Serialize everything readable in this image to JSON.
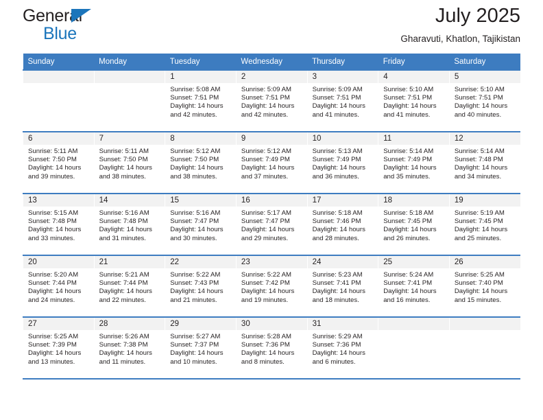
{
  "brand": {
    "name_part1": "General",
    "name_part2": "Blue",
    "logo_icon": "triangle-icon",
    "color_primary": "#1b75bb",
    "color_text": "#231f20"
  },
  "header": {
    "title": "July 2025",
    "subtitle": "Gharavuti, Khatlon, Tajikistan"
  },
  "theme": {
    "header_bg": "#3d7cc0",
    "header_text": "#ffffff",
    "daynum_bg": "#f2f2f2",
    "grid_line": "#3d7cc0"
  },
  "weekdays": [
    "Sunday",
    "Monday",
    "Tuesday",
    "Wednesday",
    "Thursday",
    "Friday",
    "Saturday"
  ],
  "weeks": [
    [
      {
        "day": "",
        "sunrise": "",
        "sunset": "",
        "daylight1": "",
        "daylight2": "",
        "empty": true
      },
      {
        "day": "",
        "sunrise": "",
        "sunset": "",
        "daylight1": "",
        "daylight2": "",
        "empty": true
      },
      {
        "day": "1",
        "sunrise": "Sunrise: 5:08 AM",
        "sunset": "Sunset: 7:51 PM",
        "daylight1": "Daylight: 14 hours",
        "daylight2": "and 42 minutes."
      },
      {
        "day": "2",
        "sunrise": "Sunrise: 5:09 AM",
        "sunset": "Sunset: 7:51 PM",
        "daylight1": "Daylight: 14 hours",
        "daylight2": "and 42 minutes."
      },
      {
        "day": "3",
        "sunrise": "Sunrise: 5:09 AM",
        "sunset": "Sunset: 7:51 PM",
        "daylight1": "Daylight: 14 hours",
        "daylight2": "and 41 minutes."
      },
      {
        "day": "4",
        "sunrise": "Sunrise: 5:10 AM",
        "sunset": "Sunset: 7:51 PM",
        "daylight1": "Daylight: 14 hours",
        "daylight2": "and 41 minutes."
      },
      {
        "day": "5",
        "sunrise": "Sunrise: 5:10 AM",
        "sunset": "Sunset: 7:51 PM",
        "daylight1": "Daylight: 14 hours",
        "daylight2": "and 40 minutes."
      }
    ],
    [
      {
        "day": "6",
        "sunrise": "Sunrise: 5:11 AM",
        "sunset": "Sunset: 7:50 PM",
        "daylight1": "Daylight: 14 hours",
        "daylight2": "and 39 minutes."
      },
      {
        "day": "7",
        "sunrise": "Sunrise: 5:11 AM",
        "sunset": "Sunset: 7:50 PM",
        "daylight1": "Daylight: 14 hours",
        "daylight2": "and 38 minutes."
      },
      {
        "day": "8",
        "sunrise": "Sunrise: 5:12 AM",
        "sunset": "Sunset: 7:50 PM",
        "daylight1": "Daylight: 14 hours",
        "daylight2": "and 38 minutes."
      },
      {
        "day": "9",
        "sunrise": "Sunrise: 5:12 AM",
        "sunset": "Sunset: 7:49 PM",
        "daylight1": "Daylight: 14 hours",
        "daylight2": "and 37 minutes."
      },
      {
        "day": "10",
        "sunrise": "Sunrise: 5:13 AM",
        "sunset": "Sunset: 7:49 PM",
        "daylight1": "Daylight: 14 hours",
        "daylight2": "and 36 minutes."
      },
      {
        "day": "11",
        "sunrise": "Sunrise: 5:14 AM",
        "sunset": "Sunset: 7:49 PM",
        "daylight1": "Daylight: 14 hours",
        "daylight2": "and 35 minutes."
      },
      {
        "day": "12",
        "sunrise": "Sunrise: 5:14 AM",
        "sunset": "Sunset: 7:48 PM",
        "daylight1": "Daylight: 14 hours",
        "daylight2": "and 34 minutes."
      }
    ],
    [
      {
        "day": "13",
        "sunrise": "Sunrise: 5:15 AM",
        "sunset": "Sunset: 7:48 PM",
        "daylight1": "Daylight: 14 hours",
        "daylight2": "and 33 minutes."
      },
      {
        "day": "14",
        "sunrise": "Sunrise: 5:16 AM",
        "sunset": "Sunset: 7:48 PM",
        "daylight1": "Daylight: 14 hours",
        "daylight2": "and 31 minutes."
      },
      {
        "day": "15",
        "sunrise": "Sunrise: 5:16 AM",
        "sunset": "Sunset: 7:47 PM",
        "daylight1": "Daylight: 14 hours",
        "daylight2": "and 30 minutes."
      },
      {
        "day": "16",
        "sunrise": "Sunrise: 5:17 AM",
        "sunset": "Sunset: 7:47 PM",
        "daylight1": "Daylight: 14 hours",
        "daylight2": "and 29 minutes."
      },
      {
        "day": "17",
        "sunrise": "Sunrise: 5:18 AM",
        "sunset": "Sunset: 7:46 PM",
        "daylight1": "Daylight: 14 hours",
        "daylight2": "and 28 minutes."
      },
      {
        "day": "18",
        "sunrise": "Sunrise: 5:18 AM",
        "sunset": "Sunset: 7:45 PM",
        "daylight1": "Daylight: 14 hours",
        "daylight2": "and 26 minutes."
      },
      {
        "day": "19",
        "sunrise": "Sunrise: 5:19 AM",
        "sunset": "Sunset: 7:45 PM",
        "daylight1": "Daylight: 14 hours",
        "daylight2": "and 25 minutes."
      }
    ],
    [
      {
        "day": "20",
        "sunrise": "Sunrise: 5:20 AM",
        "sunset": "Sunset: 7:44 PM",
        "daylight1": "Daylight: 14 hours",
        "daylight2": "and 24 minutes."
      },
      {
        "day": "21",
        "sunrise": "Sunrise: 5:21 AM",
        "sunset": "Sunset: 7:44 PM",
        "daylight1": "Daylight: 14 hours",
        "daylight2": "and 22 minutes."
      },
      {
        "day": "22",
        "sunrise": "Sunrise: 5:22 AM",
        "sunset": "Sunset: 7:43 PM",
        "daylight1": "Daylight: 14 hours",
        "daylight2": "and 21 minutes."
      },
      {
        "day": "23",
        "sunrise": "Sunrise: 5:22 AM",
        "sunset": "Sunset: 7:42 PM",
        "daylight1": "Daylight: 14 hours",
        "daylight2": "and 19 minutes."
      },
      {
        "day": "24",
        "sunrise": "Sunrise: 5:23 AM",
        "sunset": "Sunset: 7:41 PM",
        "daylight1": "Daylight: 14 hours",
        "daylight2": "and 18 minutes."
      },
      {
        "day": "25",
        "sunrise": "Sunrise: 5:24 AM",
        "sunset": "Sunset: 7:41 PM",
        "daylight1": "Daylight: 14 hours",
        "daylight2": "and 16 minutes."
      },
      {
        "day": "26",
        "sunrise": "Sunrise: 5:25 AM",
        "sunset": "Sunset: 7:40 PM",
        "daylight1": "Daylight: 14 hours",
        "daylight2": "and 15 minutes."
      }
    ],
    [
      {
        "day": "27",
        "sunrise": "Sunrise: 5:25 AM",
        "sunset": "Sunset: 7:39 PM",
        "daylight1": "Daylight: 14 hours",
        "daylight2": "and 13 minutes."
      },
      {
        "day": "28",
        "sunrise": "Sunrise: 5:26 AM",
        "sunset": "Sunset: 7:38 PM",
        "daylight1": "Daylight: 14 hours",
        "daylight2": "and 11 minutes."
      },
      {
        "day": "29",
        "sunrise": "Sunrise: 5:27 AM",
        "sunset": "Sunset: 7:37 PM",
        "daylight1": "Daylight: 14 hours",
        "daylight2": "and 10 minutes."
      },
      {
        "day": "30",
        "sunrise": "Sunrise: 5:28 AM",
        "sunset": "Sunset: 7:36 PM",
        "daylight1": "Daylight: 14 hours",
        "daylight2": "and 8 minutes."
      },
      {
        "day": "31",
        "sunrise": "Sunrise: 5:29 AM",
        "sunset": "Sunset: 7:36 PM",
        "daylight1": "Daylight: 14 hours",
        "daylight2": "and 6 minutes."
      },
      {
        "day": "",
        "sunrise": "",
        "sunset": "",
        "daylight1": "",
        "daylight2": "",
        "empty": true
      },
      {
        "day": "",
        "sunrise": "",
        "sunset": "",
        "daylight1": "",
        "daylight2": "",
        "empty": true
      }
    ]
  ]
}
